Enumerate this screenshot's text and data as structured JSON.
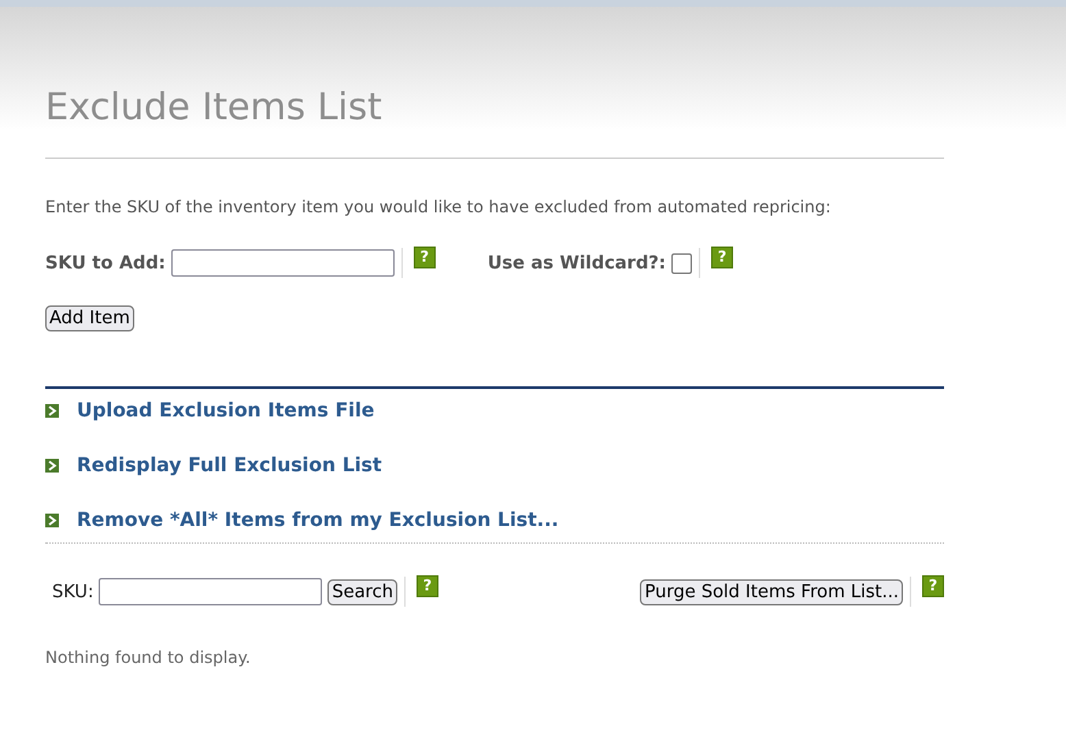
{
  "title": "Exclude Items List",
  "instruction": "Enter the SKU of the inventory item you would like to have excluded from automated repricing:",
  "add_form": {
    "sku_label": "SKU to Add:",
    "sku_help": "?",
    "wildcard_label": "Use as Wildcard?:",
    "wildcard_checked": false,
    "wildcard_help": "?",
    "button": "Add Item"
  },
  "links": [
    {
      "label": "Upload Exclusion Items File"
    },
    {
      "label": "Redisplay Full Exclusion List"
    },
    {
      "label": "Remove *All* Items from my Exclusion List..."
    }
  ],
  "search": {
    "label": "SKU:",
    "button": "Search",
    "help": "?",
    "purge_button": "Purge Sold Items From List...",
    "purge_help": "?"
  },
  "message": "Nothing found to display."
}
